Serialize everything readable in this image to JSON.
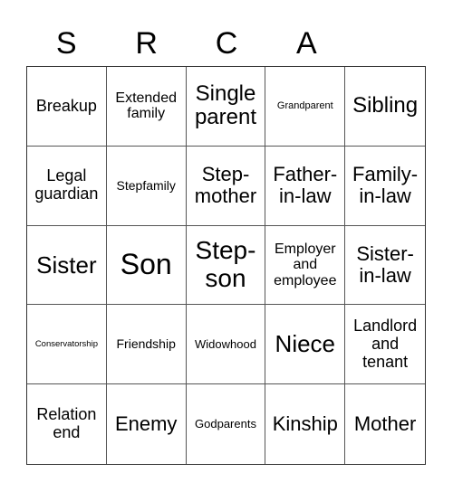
{
  "header": {
    "letters": [
      "S",
      "R",
      "C",
      "A",
      ""
    ]
  },
  "board": {
    "rows": [
      [
        "Breakup",
        "Extended family",
        "Single parent",
        "Grandparent",
        "Sibling"
      ],
      [
        "Legal guardian",
        "Stepfamily",
        "Step-mother",
        "Father-in-law",
        "Family-in-law"
      ],
      [
        "Sister",
        "Son",
        "Step-son",
        "Employer and employee",
        "Sister-in-law"
      ],
      [
        "Conservatorship",
        "Friendship",
        "Widowhood",
        "Niece",
        "Landlord and tenant"
      ],
      [
        "Relation end",
        "Enemy",
        "Godparents",
        "Kinship",
        "Mother"
      ]
    ]
  }
}
